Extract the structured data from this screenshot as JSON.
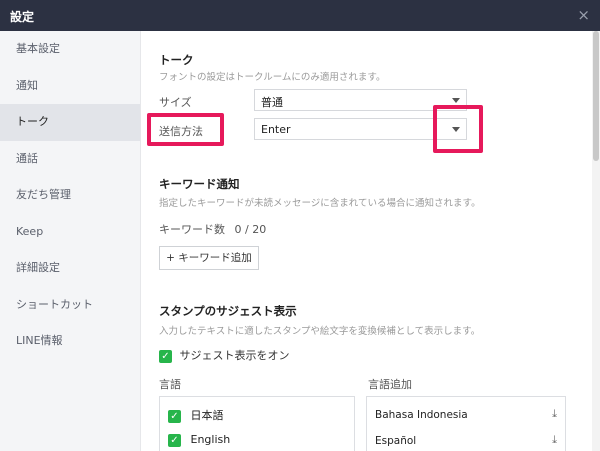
{
  "window": {
    "title": "設定",
    "close_icon": "×"
  },
  "sidebar": {
    "items": [
      {
        "label": "基本設定"
      },
      {
        "label": "通知"
      },
      {
        "label": "トーク"
      },
      {
        "label": "通話"
      },
      {
        "label": "友だち管理"
      },
      {
        "label": "Keep"
      },
      {
        "label": "詳細設定"
      },
      {
        "label": "ショートカット"
      },
      {
        "label": "LINE情報"
      }
    ],
    "active_index": 2
  },
  "talk": {
    "heading": "トーク",
    "description": "フォントの設定はトークルームにのみ適用されます。",
    "size_label": "サイズ",
    "size_value": "普通",
    "send_label": "送信方法",
    "send_value": "Enter"
  },
  "keyword": {
    "heading": "キーワード通知",
    "description": "指定したキーワードが未読メッセージに含まれている場合に通知されます。",
    "count_label": "キーワード数",
    "count_value": "0 / 20",
    "add_button": "+ キーワード追加"
  },
  "stamp": {
    "heading": "スタンプのサジェスト表示",
    "description": "入力したテキストに適したスタンプや絵文字を変換候補として表示します。",
    "toggle_label": "サジェスト表示をオン",
    "language_header": "言語",
    "add_language_header": "言語追加",
    "languages": [
      "日本語",
      "English"
    ],
    "add_languages": [
      "Bahasa Indonesia",
      "Español"
    ]
  },
  "colors": {
    "accent": "#27b54b",
    "highlight": "#e6195b",
    "titlebar": "#2c3142"
  }
}
